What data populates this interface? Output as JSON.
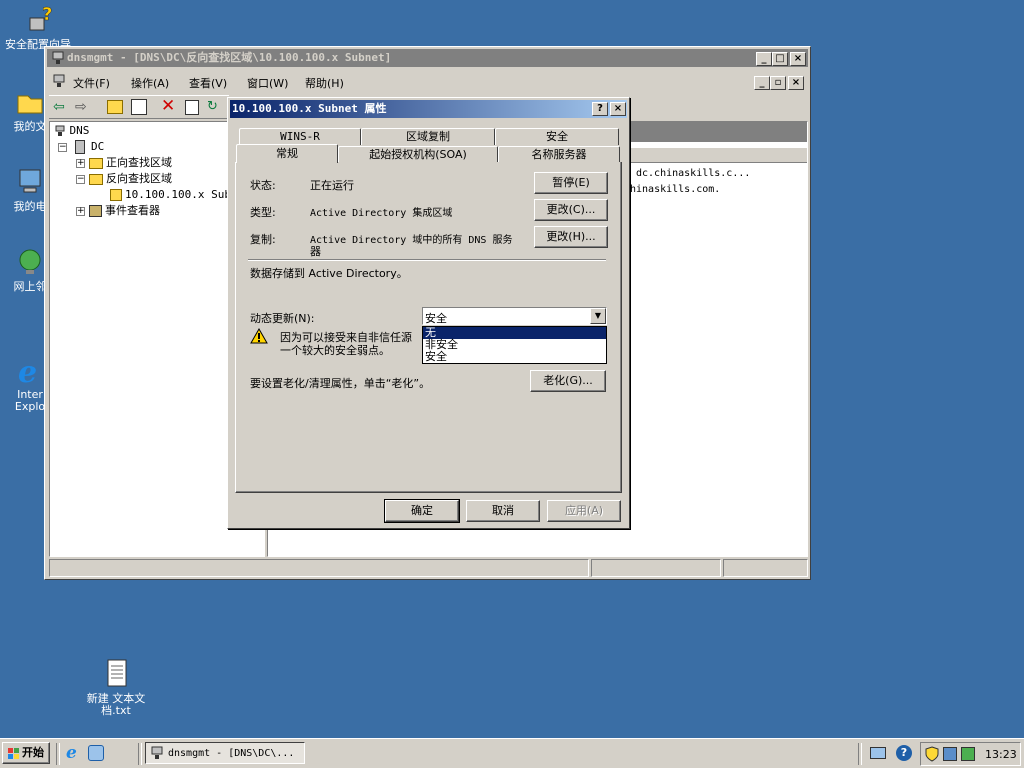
{
  "desktop": {
    "icons": [
      {
        "label": "安全配置向导"
      },
      {
        "label": "我的文"
      },
      {
        "label": "我的电"
      },
      {
        "label": "网上邻"
      },
      {
        "label": "Inter\nExplo"
      },
      {
        "label": "新建 文本文档.txt"
      }
    ]
  },
  "mmc": {
    "title": "dnsmgmt - [DNS\\DC\\反向查找区域\\10.100.100.x Subnet]",
    "menu": [
      "文件(F)",
      "操作(A)",
      "查看(V)",
      "窗口(W)",
      "帮助(H)"
    ],
    "tree": {
      "root": "DNS",
      "server": "DC",
      "forward": "正向查找区域",
      "reverse": "反向查找区域",
      "subnet": "10.100.100.x Sub",
      "events": "事件查看器"
    },
    "records": [
      "dc.chinaskills.c...",
      "hinaskills.com."
    ]
  },
  "dialog": {
    "title": "10.100.100.x Subnet 属性",
    "tabs_row1": [
      "WINS-R",
      "区域复制",
      "安全"
    ],
    "tabs_row2": [
      "常规",
      "起始授权机构(SOA)",
      "名称服务器"
    ],
    "status_label": "状态:",
    "status_value": "正在运行",
    "pause_btn": "暂停(E)",
    "type_label": "类型:",
    "type_value": "Active Directory 集成区域",
    "change_type_btn": "更改(C)...",
    "repl_label": "复制:",
    "repl_value_1": "Active Directory 域中的所有 DNS 服务",
    "repl_value_2": "器",
    "change_repl_btn": "更改(H)...",
    "stored_text": "数据存储到 Active Directory。",
    "dynupdate_label": "动态更新(N):",
    "dynupdate_value": "安全",
    "dynupdate_options": [
      "无",
      "非安全",
      "安全"
    ],
    "warning_1": "因为可以接受来自非信任源",
    "warning_2": "一个较大的安全弱点。",
    "aging_text": "要设置老化/清理属性，单击“老化”。",
    "aging_btn": "老化(G)...",
    "ok_btn": "确定",
    "cancel_btn": "取消",
    "apply_btn": "应用(A)"
  },
  "taskbar": {
    "start": "开始",
    "task": "dnsmgmt - [DNS\\DC\\...",
    "clock": "13:23"
  },
  "colors": {
    "desktop": "#3a6ea5",
    "title_active": "#0a246a",
    "title_inactive": "#808080",
    "highlight": "#0a246a"
  }
}
